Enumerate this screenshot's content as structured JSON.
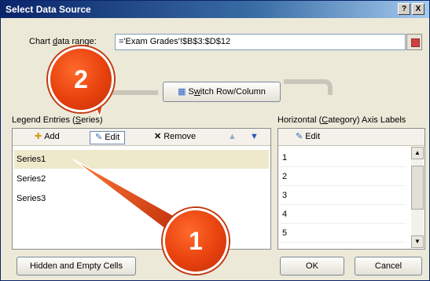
{
  "window": {
    "title": "Select Data Source",
    "help_button": "?",
    "close_button": "X"
  },
  "range": {
    "label_prefix": "Chart ",
    "label_underlined": "d",
    "label_suffix": "ata range:",
    "value": "='Exam Grades'!$B$3:$D$12"
  },
  "switch_button": {
    "label_prefix": "S",
    "label_underlined": "w",
    "label_suffix": "itch Row/Column"
  },
  "legend": {
    "heading_prefix": "Legend Entries (",
    "heading_underlined": "S",
    "heading_suffix": "eries)",
    "add_label": "Add",
    "edit_label": "Edit",
    "remove_label": "Remove",
    "series": [
      "Series1",
      "Series2",
      "Series3"
    ]
  },
  "category": {
    "heading_prefix": "Horizontal (",
    "heading_underlined": "C",
    "heading_suffix": "ategory) Axis Labels",
    "edit_label": "Edit",
    "items": [
      "1",
      "2",
      "3",
      "4",
      "5"
    ]
  },
  "footer": {
    "hidden_cells_label": "Hidden and Empty Cells",
    "ok_label": "OK",
    "cancel_label": "Cancel"
  },
  "annotations": {
    "badge_1": "1",
    "badge_2": "2"
  },
  "colors": {
    "badge": "#e7410e",
    "titlebar": "#0a246a",
    "selection": "#efe9cc"
  }
}
